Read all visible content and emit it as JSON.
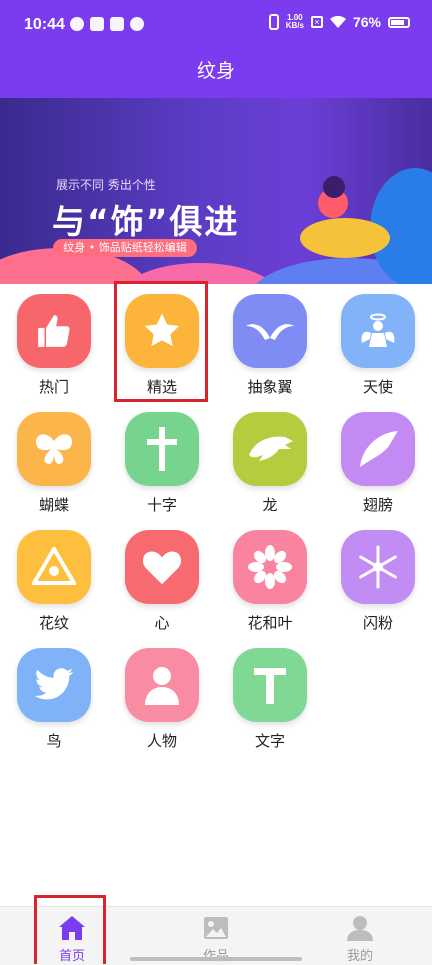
{
  "status_bar": {
    "time": "10:44",
    "speed_top": "1.00",
    "speed_bottom": "KB/s",
    "battery": "76%"
  },
  "header": {
    "title": "纹身"
  },
  "banner": {
    "subtitle": "展示不同 秀出个性",
    "title": "与“饰”俱进",
    "tagline": "纹身 • 饰品贴纸轻松编辑"
  },
  "categories": [
    {
      "label": "热门",
      "icon": "thumbs-up-icon",
      "color": "#f7666b"
    },
    {
      "label": "精选",
      "icon": "star-icon",
      "color": "#fcb43b"
    },
    {
      "label": "抽象翼",
      "icon": "wings-icon",
      "color": "#7f8cf4"
    },
    {
      "label": "天使",
      "icon": "angel-icon",
      "color": "#82b2f8"
    },
    {
      "label": "蝴蝶",
      "icon": "butterfly-icon",
      "color": "#fcb54a"
    },
    {
      "label": "十字",
      "icon": "cross-icon",
      "color": "#77d48e"
    },
    {
      "label": "龙",
      "icon": "dragon-icon",
      "color": "#b6cc3f"
    },
    {
      "label": "翅膀",
      "icon": "wing-icon",
      "color": "#c48af3"
    },
    {
      "label": "花纹",
      "icon": "triangle-pattern-icon",
      "color": "#fdbf3d"
    },
    {
      "label": "心",
      "icon": "heart-icon",
      "color": "#f76a6f"
    },
    {
      "label": "花和叶",
      "icon": "flower-icon",
      "color": "#fa84a0"
    },
    {
      "label": "闪粉",
      "icon": "snowflake-icon",
      "color": "#c18cf3"
    },
    {
      "label": "鸟",
      "icon": "bird-icon",
      "color": "#7fb2f6"
    },
    {
      "label": "人物",
      "icon": "person-icon",
      "color": "#f98ba2"
    },
    {
      "label": "文字",
      "icon": "text-icon",
      "color": "#7fd894"
    }
  ],
  "tabs": [
    {
      "label": "首页",
      "icon": "home-icon"
    },
    {
      "label": "作品",
      "icon": "image-icon"
    },
    {
      "label": "我的",
      "icon": "user-icon"
    }
  ],
  "colors": {
    "brand": "#7b3cf0",
    "highlight": "#d9232d"
  }
}
